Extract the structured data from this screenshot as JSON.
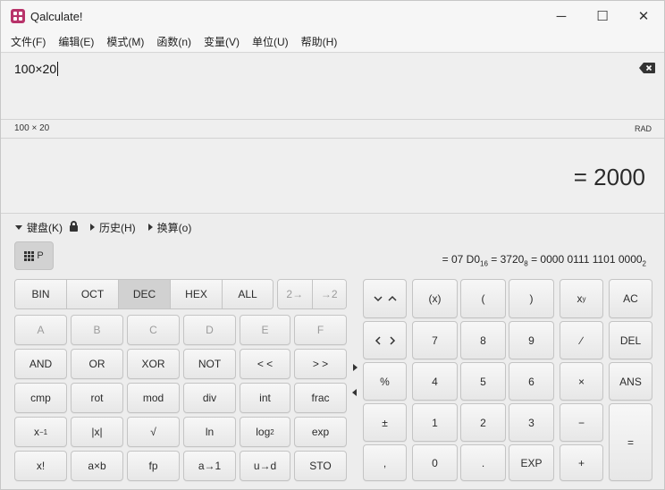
{
  "window": {
    "title": "Qalculate!",
    "minimize": "─",
    "maximize": "☐",
    "close": "✕"
  },
  "menu": [
    "文件(F)",
    "编辑(E)",
    "模式(M)",
    "函数(n)",
    "变量(V)",
    "单位(U)",
    "帮助(H)"
  ],
  "input": {
    "expression": "100×20"
  },
  "status": {
    "parsed": "100 × 20",
    "angle": "RAD"
  },
  "result": {
    "text": "= 2000"
  },
  "expanders": {
    "keypad": "键盘(K)",
    "history": "历史(H)",
    "conversion": "换算(o)"
  },
  "keypad_toggle": "P",
  "conversion": {
    "hex_value": "= 07 D0",
    "hex_base": "16",
    "oct_value": " = 3720",
    "oct_base": "8",
    "bin_value": " = 0000 0111 1101 0000",
    "bin_base": "2"
  },
  "base_buttons": [
    "BIN",
    "OCT",
    "DEC",
    "HEX",
    "ALL"
  ],
  "selected_base": "DEC",
  "shift_buttons": [
    "2→",
    "→2"
  ],
  "hex_digits": [
    "A",
    "B",
    "C",
    "D",
    "E",
    "F"
  ],
  "row_bitwise": [
    "AND",
    "OR",
    "XOR",
    "NOT",
    "< <",
    "> >"
  ],
  "row_misc": [
    "cmp",
    "rot",
    "mod",
    "div",
    "int",
    "frac"
  ],
  "row_funcs": {
    "inv_base": "x",
    "inv_exp": "−1",
    "abs": "|x|",
    "sqrt": "√",
    "ln": "ln",
    "log": "log",
    "log_base": "2",
    "exp": "exp"
  },
  "row_last": [
    "x!",
    "a×b",
    "fp",
    "a→1",
    "u→d",
    "STO"
  ],
  "numpad": {
    "paren_x": "(x)",
    "lparen": "(",
    "rparen": ")",
    "power_base": "x",
    "power_exp": "y",
    "ac": "AC",
    "seven": "7",
    "eight": "8",
    "nine": "9",
    "divide": "∕",
    "del": "DEL",
    "percent": "%",
    "four": "4",
    "five": "5",
    "six": "6",
    "multiply": "×",
    "ans": "ANS",
    "plusminus": "±",
    "one": "1",
    "two": "2",
    "three": "3",
    "minus": "−",
    "equals": "=",
    "comma": ",",
    "zero": "0",
    "dot": ".",
    "exp": "EXP",
    "plus": "+"
  }
}
